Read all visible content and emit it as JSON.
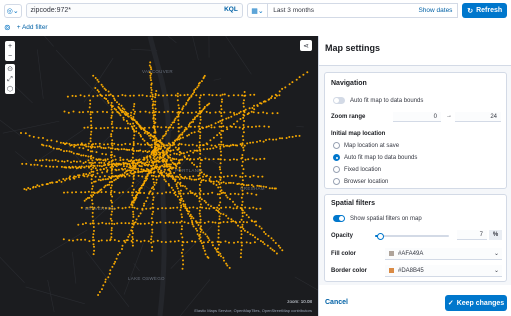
{
  "query_bar": {
    "query": "zipcode:972*",
    "kql_label": "KQL",
    "date_range": "Last 3 months",
    "show_dates_label": "Show dates",
    "refresh_label": "Refresh"
  },
  "filter_bar": {
    "add_filter_label": "+ Add filter"
  },
  "map": {
    "scale_label": "zoom: 10.08",
    "attribution": "Elastic Maps Service, OpenMapTiles, OpenStreetMap contributors",
    "tools": [
      "plus-icon",
      "minus-icon",
      "compass-icon",
      "fullscreen-icon",
      "shape-tool-icon"
    ],
    "point_color": "#f5a700",
    "background": "#1b1c1f"
  },
  "panel": {
    "title": "Map settings",
    "navigation": {
      "title": "Navigation",
      "auto_fit_label": "Auto fit map to data bounds",
      "auto_fit_enabled": false,
      "zoom_range_label": "Zoom range",
      "zoom_min": "0",
      "zoom_max": "24",
      "initial_location_label": "Initial map location",
      "location_options": [
        {
          "label": "Map location at save",
          "checked": false
        },
        {
          "label": "Auto fit map to data bounds",
          "checked": true
        },
        {
          "label": "Fixed location",
          "checked": false
        },
        {
          "label": "Browser location",
          "checked": false
        }
      ]
    },
    "spatial_filters": {
      "title": "Spatial filters",
      "show_label": "Show spatial filters on map",
      "show_enabled": true,
      "opacity_label": "Opacity",
      "opacity_value": "7",
      "opacity_fraction": 0.07,
      "opacity_unit": "%",
      "fill_color_label": "Fill color",
      "fill_color_value": "#AFA49A",
      "fill_color": "#AFA49A",
      "border_color_label": "Border color",
      "border_color_value": "#DA8B45",
      "border_color": "#DA8B45"
    },
    "footer": {
      "cancel_label": "Cancel",
      "keep_label": "Keep changes"
    }
  }
}
